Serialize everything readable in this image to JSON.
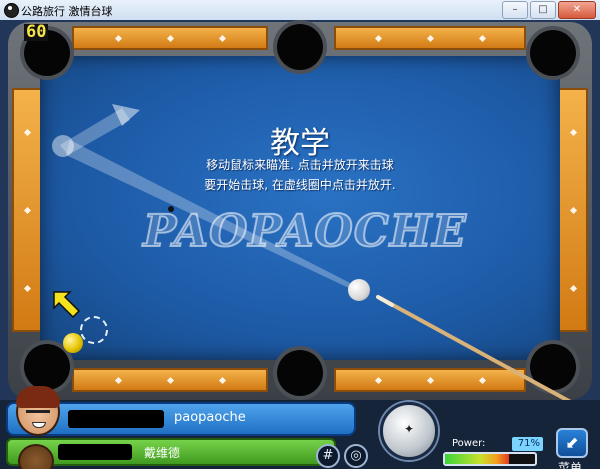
{
  "window": {
    "title": "公路旅行 激情台球",
    "buttons": [
      "–",
      "□",
      "✕"
    ]
  },
  "game": {
    "fps": "60",
    "tutorial": {
      "title": "教学",
      "line1": "移动鼠标来瞄准. 点击并放开来击球",
      "line2": "要开始击球, 在虚线圈中点击并放开."
    },
    "watermark": "PAOPAOCHE",
    "colors": {
      "felt": "#1d5aa6",
      "rail": "#e3951f",
      "player1_bar": "#2f86d8",
      "player2_bar": "#56b531"
    }
  },
  "hud": {
    "player1": {
      "name": "paopaoche"
    },
    "player2": {
      "name": "戴维德"
    },
    "buttons": {
      "grid_icon": "#",
      "target_icon": "◎"
    },
    "power": {
      "label": "Power:",
      "percent_text": "71%",
      "value": 0.71
    },
    "menu_label": "菜单"
  }
}
